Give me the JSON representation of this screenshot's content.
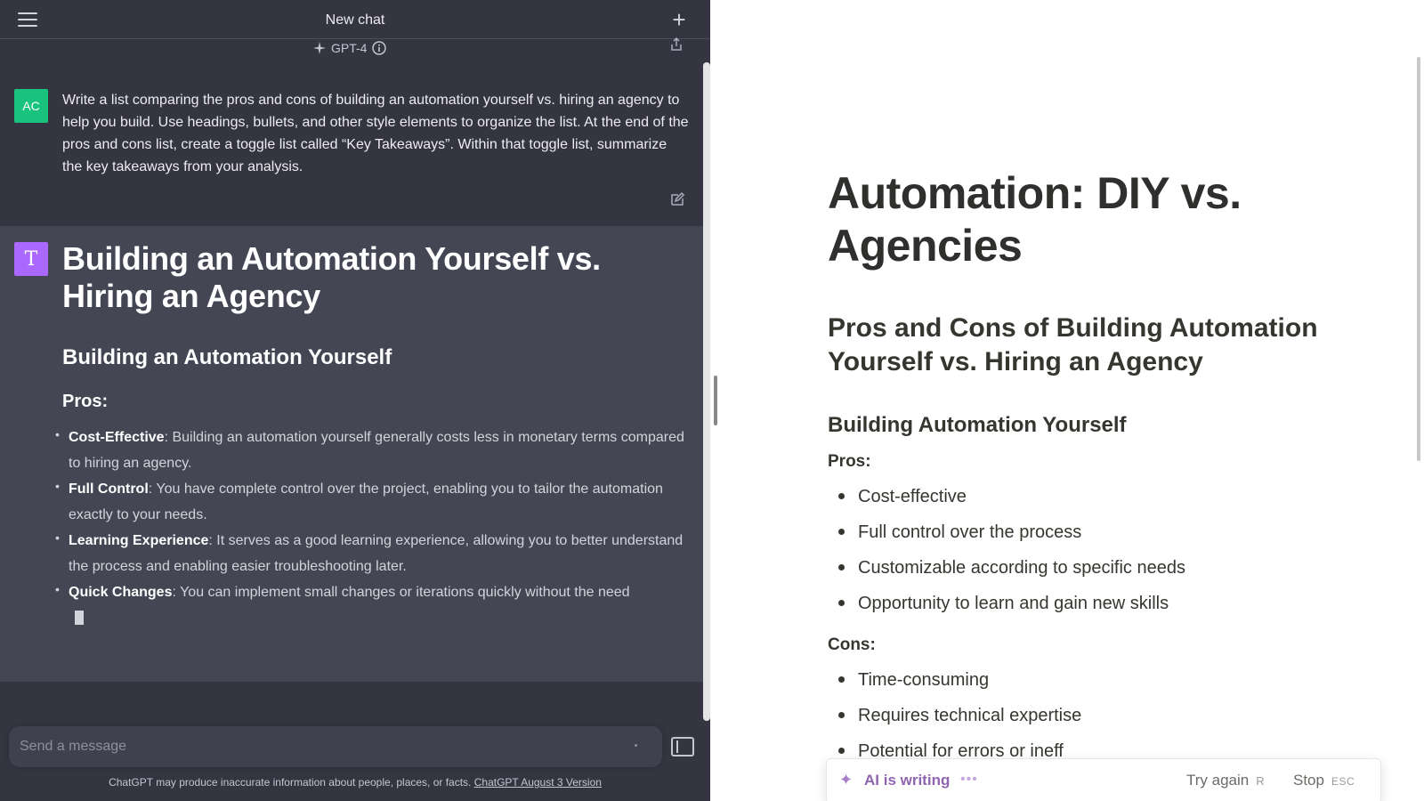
{
  "chatgpt": {
    "title": "New chat",
    "model": "GPT-4",
    "user": {
      "avatar": "AC",
      "message": "Write a list comparing the pros and cons of building an automation yourself vs. hiring an agency to help you build. Use headings, bullets, and other style elements to organize the list. At the end of the pros and cons list, create a toggle list called “Key Takeaways”. Within that toggle list, summarize the key takeaways from your analysis."
    },
    "assistant": {
      "avatar": "T",
      "h1": "Building an Automation Yourself vs. Hiring an Agency",
      "h2": "Building an Automation Yourself",
      "pros_label": "Pros:",
      "items": [
        {
          "term": "Cost-Effective",
          "text": ": Building an automation yourself generally costs less in monetary terms compared to hiring an agency."
        },
        {
          "term": "Full Control",
          "text": ": You have complete control over the project, enabling you to tailor the automation exactly to your needs."
        },
        {
          "term": "Learning Experience",
          "text": ": It serves as a good learning experience, allowing you to better understand the process and enabling easier troubleshooting later."
        },
        {
          "term": "Quick Changes",
          "text": ": You can implement small changes or iterations quickly without the need"
        }
      ]
    },
    "input": {
      "placeholder": "Send a message"
    },
    "disclaimer": {
      "text": "ChatGPT may produce inaccurate information about people, places, or facts. ",
      "link": "ChatGPT August 3 Version"
    },
    "icons": [
      "menu-icon",
      "plus-icon",
      "sparkle-icon",
      "info-icon",
      "share-icon",
      "edit-icon",
      "sidebar-toggle-icon"
    ]
  },
  "notion": {
    "title": "Automation: DIY vs. Agencies",
    "h2": "Pros and Cons of Building Automation Yourself vs. Hiring an Agency",
    "h3": "Building Automation Yourself",
    "pros_label": "Pros:",
    "pros": [
      "Cost-effective",
      "Full control over the process",
      "Customizable according to specific needs",
      "Opportunity to learn and gain new skills"
    ],
    "cons_label": "Cons:",
    "cons": [
      "Time-consuming",
      "Requires technical expertise",
      "Potential for errors or ineff"
    ],
    "ai_bar": {
      "status": "AI is writing",
      "try_again": "Try again",
      "try_again_key": "R",
      "stop": "Stop",
      "stop_key": "ESC"
    }
  },
  "colors": {
    "chat_bg": "#343541",
    "assistant_bg": "#444654",
    "user_avatar": "#19c37d",
    "assistant_avatar": "#ab68ff",
    "ai_purple": "#9065b0"
  }
}
